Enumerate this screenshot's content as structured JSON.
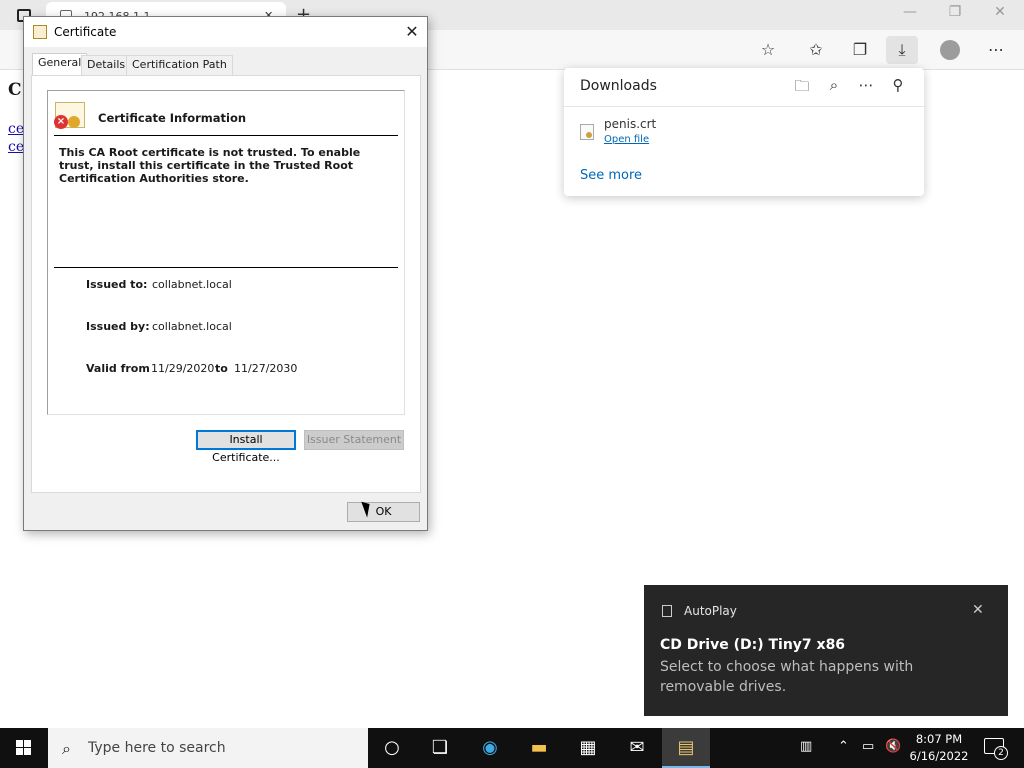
{
  "browser": {
    "tab_title": "192.168.1.1",
    "tab_close": "✕",
    "new_tab": "+",
    "minimize": "—",
    "restore": "❐",
    "close": "✕",
    "toolbar_icons": [
      "add-favorite-icon",
      "favorites-icon",
      "collections-icon",
      "downloads-icon",
      "profile-icon",
      "more-icon"
    ]
  },
  "page": {
    "heading_fragment": "C",
    "link_fragments": [
      "ce",
      "ce"
    ]
  },
  "downloads": {
    "title": "Downloads",
    "items": [
      {
        "filename": "penis.crt",
        "action": "Open file"
      }
    ],
    "see_more": "See more"
  },
  "certificate_dialog": {
    "title": "Certificate",
    "tabs": [
      "General",
      "Details",
      "Certification Path"
    ],
    "selected_tab": "General",
    "info_heading": "Certificate Information",
    "message": "This CA Root certificate is not trusted. To enable trust, install this certificate in the Trusted Root Certification Authorities store.",
    "issued_to_label": "Issued to:",
    "issued_to": "collabnet.local",
    "issued_by_label": "Issued by:",
    "issued_by": "collabnet.local",
    "valid_from_label": "Valid from",
    "valid_from": "11/29/2020",
    "to_label": "to",
    "valid_to": "11/27/2030",
    "install_button": "Install Certificate...",
    "issuer_statement_button": "Issuer Statement",
    "ok_button": "OK"
  },
  "toast": {
    "app": "AutoPlay",
    "title": "CD Drive (D:) Tiny7 x86",
    "body": "Select to choose what happens with removable drives."
  },
  "taskbar": {
    "search_placeholder": "Type here to search",
    "apps": [
      "cortana-icon",
      "task-view-icon",
      "edge-icon",
      "file-explorer-icon",
      "store-icon",
      "mail-icon",
      "certificate-app-icon"
    ],
    "time": "8:07 PM",
    "date": "6/16/2022",
    "notification_count": "2"
  }
}
